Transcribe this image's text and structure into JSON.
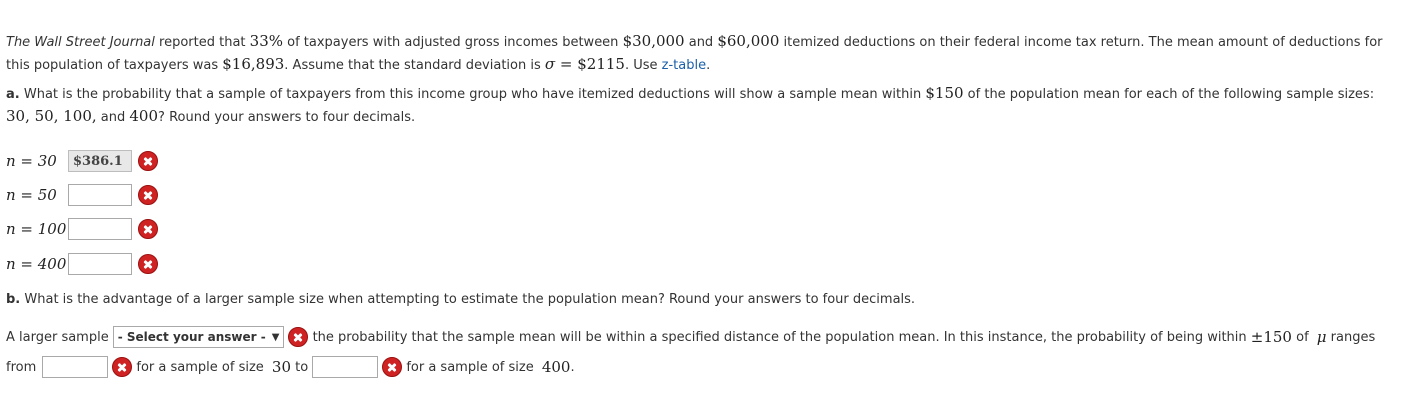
{
  "intro": {
    "source": "The Wall Street Journal",
    "t1": " reported that ",
    "pct": "33%",
    "t2": " of taxpayers with adjusted gross incomes between ",
    "low": "$30,000",
    "t3": " and ",
    "high": "$60,000",
    "t4": " itemized deductions on their federal income tax return. The mean amount of deductions for",
    "t5": "this population of taxpayers was ",
    "mean": "$16,893",
    "t6": ". Assume that the standard deviation is ",
    "sigma": "σ",
    "eq": " = ",
    "sd": "$2115",
    "t7": ". Use ",
    "link": "z-table",
    "t8": "."
  },
  "part_a": {
    "prefix": "a.",
    "t1": " What is the probability that a sample of taxpayers from this income group who have itemized deductions will show a sample mean within ",
    "within": "$150",
    "t2": " of the population mean for each of the following sample sizes:",
    "sizes": "30, 50, 100,",
    "t3": " and ",
    "size4": "400",
    "t4": "? Round your answers to four decimals."
  },
  "rows": [
    {
      "label": "n = 30",
      "value": "$386.1"
    },
    {
      "label": "n = 50",
      "value": ""
    },
    {
      "label": "n = 100",
      "value": ""
    },
    {
      "label": "n = 400",
      "value": ""
    }
  ],
  "part_b": {
    "prefix": "b.",
    "question": " What is the advantage of a larger sample size when attempting to estimate the population mean? Round your answers to four decimals.",
    "s1": "A larger sample",
    "select": "- Select your answer -",
    "s2": " the probability that the sample mean will be within a specified distance of the population mean. In this instance, the probability of being within ",
    "pm": "±150",
    "s3": " of ",
    "mu": "μ",
    "s4": " ranges",
    "s5": "from",
    "s6": " for a sample of size ",
    "n1": "30",
    "s7": " to",
    "s8": " for a sample of size ",
    "n2": "400",
    "s9": "."
  },
  "colors": {
    "error": "#cf2222",
    "link": "#1a5fa8"
  },
  "icons": {
    "error": "x-circle-icon",
    "dropdown": "chevron-down-icon"
  }
}
